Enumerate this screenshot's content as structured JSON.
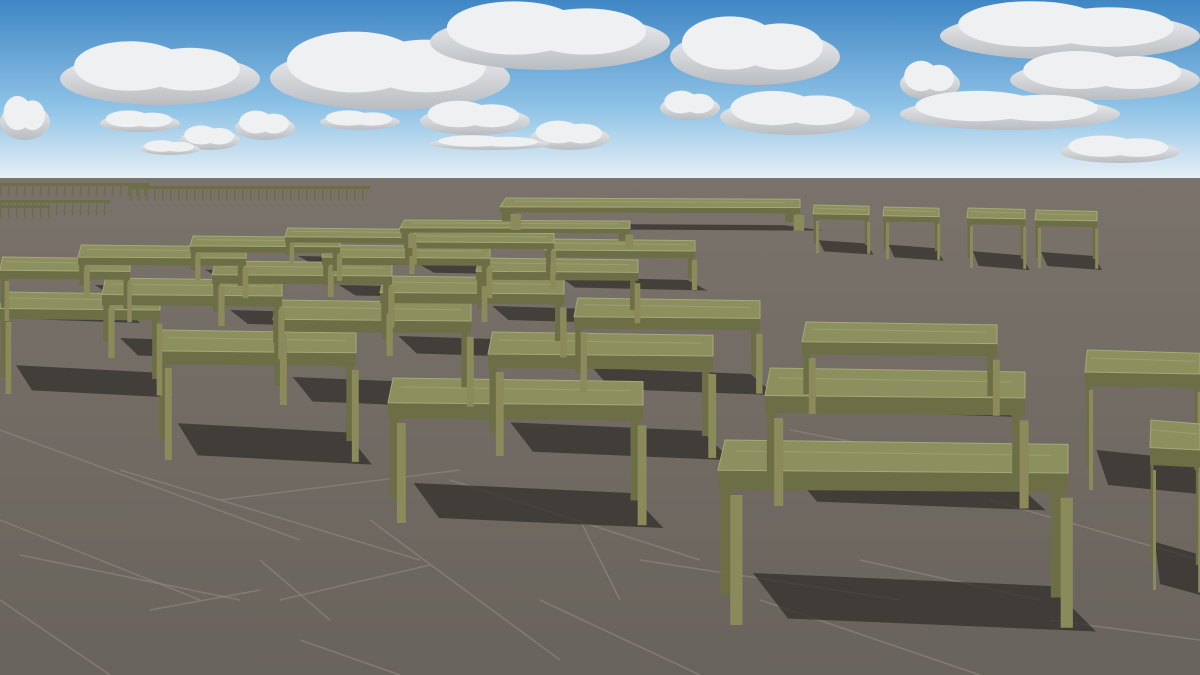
{
  "scene": {
    "description_kind": "3d-viewport",
    "colors": {
      "sky_top": "#3f86c4",
      "sky_mid": "#8fc3e6",
      "sky_horizon": "#e9f1f6",
      "ground_far": "#7a736b",
      "ground_near": "#69635d",
      "tile_line": "#8a847c",
      "shadow": "#2e2b28",
      "table_top": "#8c8f5e",
      "table_top_light": "#a6a878",
      "table_side": "#6c6e45",
      "table_leg": "#8a8a5a",
      "cloud": "#eef0f2",
      "cloud_shade": "#b9bcc0"
    },
    "object_type": "table",
    "table_count_visible": 40
  }
}
